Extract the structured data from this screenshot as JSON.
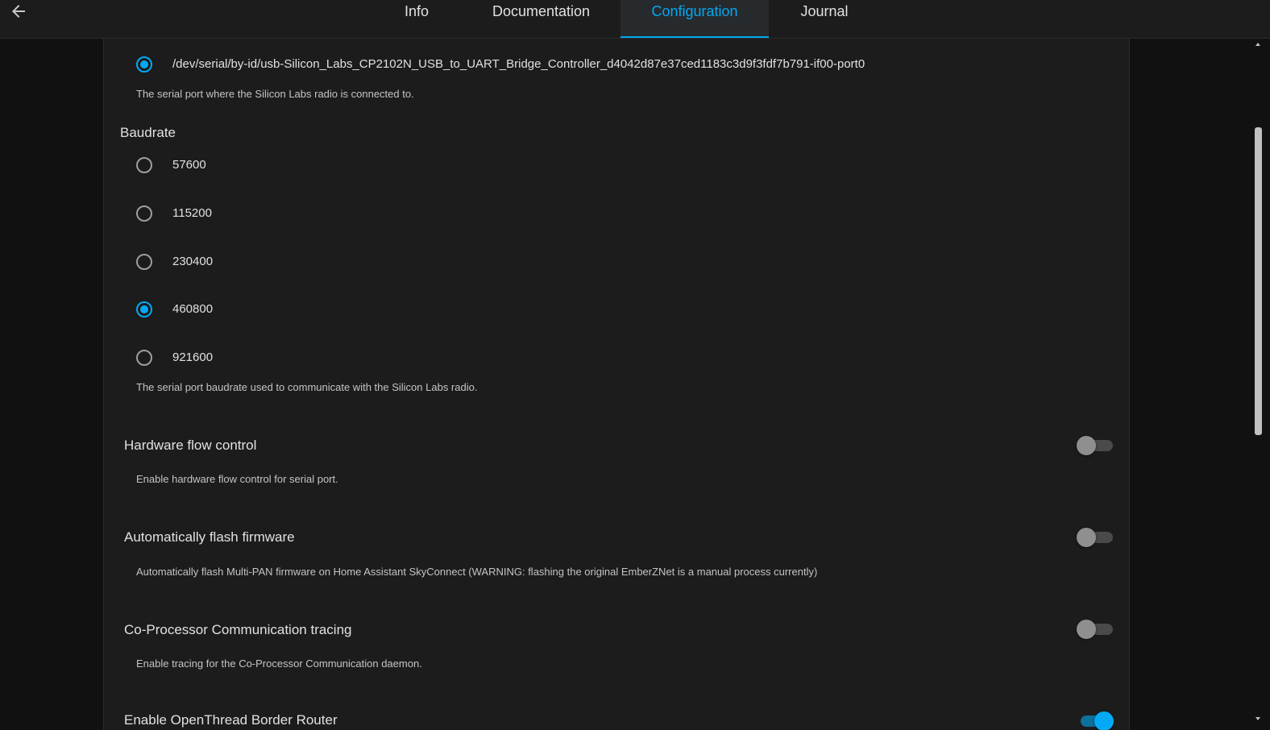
{
  "tabs": [
    {
      "label": "Info",
      "active": false
    },
    {
      "label": "Documentation",
      "active": false
    },
    {
      "label": "Configuration",
      "active": true
    },
    {
      "label": "Journal",
      "active": false
    }
  ],
  "device": {
    "value": "/dev/serial/by-id/usb-Silicon_Labs_CP2102N_USB_to_UART_Bridge_Controller_d4042d87e37ced1183c3d9f3fdf7b791-if00-port0",
    "selected": true,
    "helper": "The serial port where the Silicon Labs radio is connected to."
  },
  "baudrate": {
    "title": "Baudrate",
    "options": [
      {
        "label": "57600",
        "selected": false
      },
      {
        "label": "115200",
        "selected": false
      },
      {
        "label": "230400",
        "selected": false
      },
      {
        "label": "460800",
        "selected": true
      },
      {
        "label": "921600",
        "selected": false
      }
    ],
    "helper": "The serial port baudrate used to communicate with the Silicon Labs radio."
  },
  "hardware_flow_control": {
    "title": "Hardware flow control",
    "helper": "Enable hardware flow control for serial port.",
    "enabled": false
  },
  "auto_flash": {
    "title": "Automatically flash firmware",
    "helper": "Automatically flash Multi-PAN firmware on Home Assistant SkyConnect (WARNING: flashing the original EmberZNet is a manual process currently)",
    "enabled": false
  },
  "cpc_tracing": {
    "title": "Co-Processor Communication tracing",
    "helper": "Enable tracing for the Co-Processor Communication daemon.",
    "enabled": false
  },
  "otbr": {
    "title": "Enable OpenThread Border Router",
    "enabled": true
  },
  "colors": {
    "accent": "#03a9f4",
    "background": "#111111",
    "card": "#1c1c1c"
  },
  "icons": {
    "back": "arrow-left-icon"
  }
}
